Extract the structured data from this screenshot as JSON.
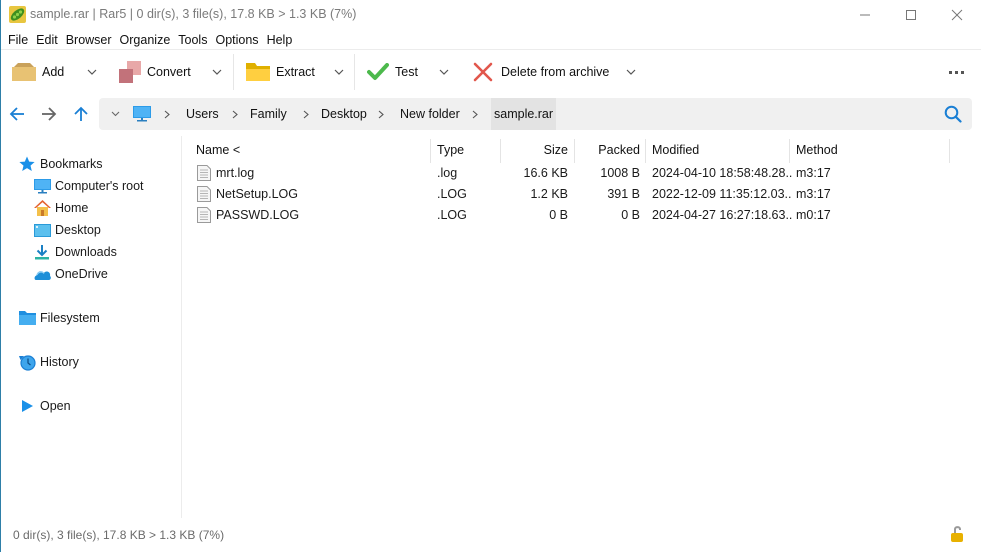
{
  "window": {
    "title": "sample.rar | Rar5 | 0 dir(s), 3 file(s), 17.8 KB > 1.3 KB (7%)",
    "app_icon": "peazip-pea-icon",
    "controls": [
      "minimize",
      "maximize",
      "close"
    ]
  },
  "menu": {
    "items": [
      "File",
      "Edit",
      "Browser",
      "Organize",
      "Tools",
      "Options",
      "Help"
    ]
  },
  "toolbar": {
    "buttons": [
      {
        "label": "Add",
        "icon": "add-box-icon"
      },
      {
        "label": "Convert",
        "icon": "convert-icon"
      },
      {
        "label": "Extract",
        "icon": "extract-folder-icon"
      },
      {
        "label": "Test",
        "icon": "checkmark-icon"
      },
      {
        "label": "Delete from archive",
        "icon": "delete-x-icon"
      }
    ],
    "more_icon": "more-ellipsis-icon"
  },
  "nav": {
    "back_icon": "arrow-left-icon",
    "forward_icon": "arrow-right-icon",
    "up_icon": "arrow-up-icon",
    "breadcrumb": [
      "Users",
      "Family",
      "Desktop",
      "New folder",
      "sample.rar"
    ],
    "search_icon": "search-icon"
  },
  "sidebar": {
    "bookmarks_label": "Bookmarks",
    "bookmarks": [
      {
        "label": "Computer's root",
        "icon": "monitor-icon"
      },
      {
        "label": "Home",
        "icon": "home-icon"
      },
      {
        "label": "Desktop",
        "icon": "desktop-icon"
      },
      {
        "label": "Downloads",
        "icon": "download-icon"
      },
      {
        "label": "OneDrive",
        "icon": "cloud-icon"
      }
    ],
    "filesystem_label": "Filesystem",
    "history_label": "History",
    "open_label": "Open"
  },
  "file_list": {
    "columns": [
      "Name <",
      "Type",
      "Size",
      "Packed",
      "Modified",
      "Method"
    ],
    "rows": [
      {
        "name": "mrt.log",
        "type": ".log",
        "size": "16.6 KB",
        "packed": "1008 B",
        "modified": "2024-04-10 18:58:48.28...",
        "method": "m3:17"
      },
      {
        "name": "NetSetup.LOG",
        "type": ".LOG",
        "size": "1.2 KB",
        "packed": "391 B",
        "modified": "2022-12-09 11:35:12.03...",
        "method": "m3:17"
      },
      {
        "name": "PASSWD.LOG",
        "type": ".LOG",
        "size": "0 B",
        "packed": "0 B",
        "modified": "2024-04-27 16:27:18.63...",
        "method": "m0:17"
      }
    ]
  },
  "status": {
    "text": "0 dir(s), 3 file(s), 17.8 KB > 1.3 KB (7%)",
    "lock_icon": "unlocked-padlock-icon"
  },
  "colors": {
    "accent": "#1a7fd4",
    "window_border": "#2e7fa8",
    "lock": "#e8b100"
  }
}
